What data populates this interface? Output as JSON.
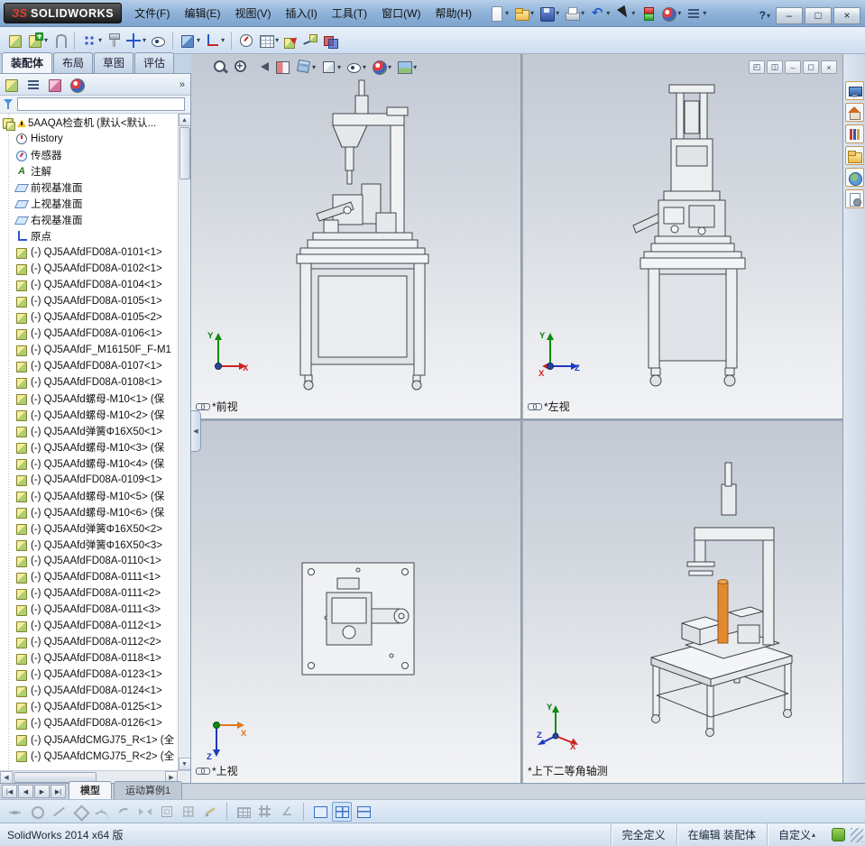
{
  "glyphs": {
    "caret": "▾",
    "caret_up": "▴",
    "overflow": "»",
    "up": "▲",
    "down": "▼",
    "left": "◀",
    "right": "▶"
  },
  "icons": {
    "annotation_glyph": "A"
  },
  "titlebar": {
    "logo_mark": "ЗS",
    "logo_text": "SOLIDWORKS",
    "menus": [
      "文件(F)",
      "编辑(E)",
      "视图(V)",
      "插入(I)",
      "工具(T)",
      "窗口(W)",
      "帮助(H)"
    ],
    "quick_icons": [
      {
        "name": "new-document",
        "style": "ic-page",
        "caret": true
      },
      {
        "name": "open",
        "style": "ic-folder",
        "caret": true
      },
      {
        "name": "save",
        "style": "ic-disk",
        "caret": true
      },
      {
        "name": "print",
        "style": "ic-printer",
        "caret": true
      },
      {
        "name": "undo",
        "style": "ic-undo",
        "glyph": "↶",
        "caret": true
      },
      {
        "name": "select",
        "style": "ic-cursor",
        "caret": true
      },
      {
        "name": "rebuild",
        "style": "ic-rebuild"
      },
      {
        "name": "edit-appearance",
        "style": "ic-ball",
        "caret": true
      },
      {
        "name": "options",
        "style": "ic-list",
        "caret": true
      }
    ],
    "help_glyph": "?",
    "window_buttons": [
      {
        "name": "minimize",
        "glyph": "–"
      },
      {
        "name": "maximize",
        "glyph": "□"
      },
      {
        "name": "close",
        "glyph": "×"
      }
    ]
  },
  "assembly_toolbar": [
    {
      "name": "edit-component",
      "style": "ic-cubeY"
    },
    {
      "name": "insert-components",
      "style": "ic-cubeAdd",
      "caret": true
    },
    {
      "name": "mate",
      "style": "ic-clip"
    },
    {
      "type": "sep"
    },
    {
      "name": "linear-component-pattern",
      "style": "ic-grid",
      "caret": true
    },
    {
      "name": "smart-fasteners",
      "style": "ic-bolt"
    },
    {
      "name": "move-component",
      "style": "ic-move",
      "caret": true
    },
    {
      "name": "show-hidden-components",
      "style": "ic-eye"
    },
    {
      "type": "sep"
    },
    {
      "name": "assembly-features",
      "style": "ic-cubeB",
      "caret": true
    },
    {
      "name": "reference-geometry",
      "style": "ic-axis",
      "caret": true
    },
    {
      "type": "sep"
    },
    {
      "name": "new-motion-study",
      "style": "ic-motion"
    },
    {
      "name": "bill-of-materials",
      "style": "ic-bom",
      "caret": true
    },
    {
      "name": "exploded-view",
      "style": "ic-explode"
    },
    {
      "name": "explode-line-sketch",
      "style": "ic-sketchline"
    },
    {
      "name": "interference-detection",
      "style": "ic-interf"
    }
  ],
  "command_tabs": [
    {
      "label": "装配体",
      "active": true
    },
    {
      "label": "布局",
      "active": false
    },
    {
      "label": "草图",
      "active": false
    },
    {
      "label": "评估",
      "active": false
    }
  ],
  "feature_panel": {
    "toolbar": [
      {
        "name": "featuremanager-design-tree",
        "style": "ic-cubeY"
      },
      {
        "name": "property-manager",
        "style": "ic-list"
      },
      {
        "name": "configuration-manager",
        "style": "ic-cubeP"
      },
      {
        "name": "display-manager",
        "style": "ic-ball"
      }
    ],
    "filter": {
      "value": ""
    },
    "root": {
      "label": "5AAQA检查机 (默认<默认..."
    },
    "items": [
      {
        "label": "History",
        "icon": "history"
      },
      {
        "label": "传感器",
        "icon": "sensor"
      },
      {
        "label": "注解",
        "icon": "ann"
      },
      {
        "label": "前视基准面",
        "icon": "plane"
      },
      {
        "label": "上视基准面",
        "icon": "plane"
      },
      {
        "label": "右视基准面",
        "icon": "plane"
      },
      {
        "label": "原点",
        "icon": "origin"
      },
      {
        "label": "(-) QJ5AAfdFD08A-0101<1>",
        "icon": "part"
      },
      {
        "label": "(-) QJ5AAfdFD08A-0102<1>",
        "icon": "part"
      },
      {
        "label": "(-) QJ5AAfdFD08A-0104<1>",
        "icon": "part"
      },
      {
        "label": "(-) QJ5AAfdFD08A-0105<1>",
        "icon": "part"
      },
      {
        "label": "(-) QJ5AAfdFD08A-0105<2>",
        "icon": "part"
      },
      {
        "label": "(-) QJ5AAfdFD08A-0106<1>",
        "icon": "part"
      },
      {
        "label": "(-) QJ5AAfdF_M16150F_F-M1",
        "icon": "part"
      },
      {
        "label": "(-) QJ5AAfdFD08A-0107<1>",
        "icon": "part"
      },
      {
        "label": "(-) QJ5AAfdFD08A-0108<1>",
        "icon": "part"
      },
      {
        "label": "(-) QJ5AAfd螺母-M10<1> (保",
        "icon": "part"
      },
      {
        "label": "(-) QJ5AAfd螺母-M10<2> (保",
        "icon": "part"
      },
      {
        "label": "(-) QJ5AAfd弹簧Φ16X50<1>",
        "icon": "part"
      },
      {
        "label": "(-) QJ5AAfd螺母-M10<3> (保",
        "icon": "part"
      },
      {
        "label": "(-) QJ5AAfd螺母-M10<4> (保",
        "icon": "part"
      },
      {
        "label": "(-) QJ5AAfdFD08A-0109<1>",
        "icon": "part"
      },
      {
        "label": "(-) QJ5AAfd螺母-M10<5> (保",
        "icon": "part"
      },
      {
        "label": "(-) QJ5AAfd螺母-M10<6> (保",
        "icon": "part"
      },
      {
        "label": "(-) QJ5AAfd弹簧Φ16X50<2>",
        "icon": "part"
      },
      {
        "label": "(-) QJ5AAfd弹簧Φ16X50<3>",
        "icon": "part"
      },
      {
        "label": "(-) QJ5AAfdFD08A-0110<1>",
        "icon": "part"
      },
      {
        "label": "(-) QJ5AAfdFD08A-0111<1>",
        "icon": "part"
      },
      {
        "label": "(-) QJ5AAfdFD08A-0111<2>",
        "icon": "part"
      },
      {
        "label": "(-) QJ5AAfdFD08A-0111<3>",
        "icon": "part"
      },
      {
        "label": "(-) QJ5AAfdFD08A-0112<1>",
        "icon": "part"
      },
      {
        "label": "(-) QJ5AAfdFD08A-0112<2>",
        "icon": "part"
      },
      {
        "label": "(-) QJ5AAfdFD08A-0118<1>",
        "icon": "part"
      },
      {
        "label": "(-) QJ5AAfdFD08A-0123<1>",
        "icon": "part"
      },
      {
        "label": "(-) QJ5AAfdFD08A-0124<1>",
        "icon": "part"
      },
      {
        "label": "(-) QJ5AAfdFD08A-0125<1>",
        "icon": "part"
      },
      {
        "label": "(-) QJ5AAfdFD08A-0126<1>",
        "icon": "part"
      },
      {
        "label": "(-) QJ5AAfdCMGJ75_R<1> (全",
        "icon": "part"
      },
      {
        "label": "(-) QJ5AAfdCMGJ75_R<2> (全",
        "icon": "part"
      }
    ]
  },
  "hud": [
    {
      "name": "zoom-fit",
      "style": "hi-zoomfit"
    },
    {
      "name": "zoom-to-area",
      "style": "hi-zoomarea"
    },
    {
      "name": "previous-view",
      "style": "hi-prev"
    },
    {
      "name": "section-view",
      "style": "hi-section"
    },
    {
      "name": "view-orientation",
      "style": "hi-orient",
      "caret": true
    },
    {
      "name": "display-style",
      "style": "hi-display",
      "caret": true
    },
    {
      "name": "hide-show-items",
      "style": "ic-eye",
      "caret": true
    },
    {
      "name": "edit-appearance",
      "style": "ic-ball",
      "caret": true
    },
    {
      "name": "scene-settings",
      "style": "hi-scene",
      "caret": true
    }
  ],
  "viewport_controls": [
    {
      "name": "viewport-previous",
      "glyph": "◰"
    },
    {
      "name": "viewport-split",
      "glyph": "◫"
    },
    {
      "name": "viewport-minimize",
      "glyph": "–"
    },
    {
      "name": "viewport-maximize",
      "glyph": "◻"
    },
    {
      "name": "viewport-close",
      "glyph": "×"
    }
  ],
  "task_pane": [
    {
      "name": "solidworks-resources",
      "style": "tp-res"
    },
    {
      "name": "design-library",
      "style": "tp-home"
    },
    {
      "name": "file-explorer",
      "style": "tp-lib"
    },
    {
      "name": "view-palette",
      "style": "ic-folder"
    },
    {
      "name": "appearances-scenes",
      "style": "tp-globe"
    },
    {
      "name": "custom-properties",
      "style": "tp-props"
    }
  ],
  "viewports": [
    {
      "label": "*前视",
      "triad": {
        "up": "Y",
        "right": "X"
      }
    },
    {
      "label": "*左视",
      "triad": {
        "up": "Y",
        "right": "Z",
        "toward": "X"
      }
    },
    {
      "label": "*上视",
      "triad": {
        "right": "X",
        "down": "Z"
      }
    },
    {
      "label": "*上下二等角轴测",
      "triad": {
        "up": "Y",
        "right": "X",
        "left": "Z"
      }
    }
  ],
  "model_area": {
    "nav": [
      {
        "name": "first",
        "glyph": "|◀"
      },
      {
        "name": "previous",
        "glyph": "◀"
      },
      {
        "name": "next",
        "glyph": "▶"
      },
      {
        "name": "last",
        "glyph": "▶|"
      }
    ],
    "tabs": [
      {
        "label": "模型",
        "active": true
      },
      {
        "label": "运动算例1",
        "active": false
      }
    ]
  },
  "sketch_toolbar": [
    {
      "name": "trim-entities",
      "style": "sw-wave"
    },
    {
      "name": "circle",
      "style": "sw-circle"
    },
    {
      "name": "line",
      "style": "sw-line"
    },
    {
      "name": "polygon",
      "style": "sw-diamond"
    },
    {
      "name": "spline",
      "style": "sw-spline"
    },
    {
      "name": "three-point-arc",
      "style": "sw-arc"
    },
    {
      "name": "mirror-entities",
      "style": "sw-mirror"
    },
    {
      "name": "offset-entities",
      "style": "sw-offset"
    },
    {
      "name": "linear-sketch-pattern",
      "style": "sw-grid9"
    },
    {
      "name": "smart-dimension",
      "style": "sw-pencil"
    },
    {
      "type": "sep"
    },
    {
      "name": "table",
      "style": "sw-table"
    },
    {
      "name": "snap-grid",
      "style": "sw-hash"
    },
    {
      "name": "angle-snap",
      "style": "sw-angle",
      "glyph": "∠"
    },
    {
      "type": "sep"
    },
    {
      "name": "viewport-single",
      "style": "sw-vp1",
      "enabled": true
    },
    {
      "name": "viewport-four",
      "style": "sw-vp4",
      "enabled": true,
      "active": true
    },
    {
      "name": "viewport-two-horizontal",
      "style": "sw-vp2",
      "enabled": true
    }
  ],
  "status_bar": {
    "app_version": "SolidWorks 2014 x64 版",
    "define_status": "完全定义",
    "edit_status": "在编辑 装配体",
    "units": "自定义"
  }
}
